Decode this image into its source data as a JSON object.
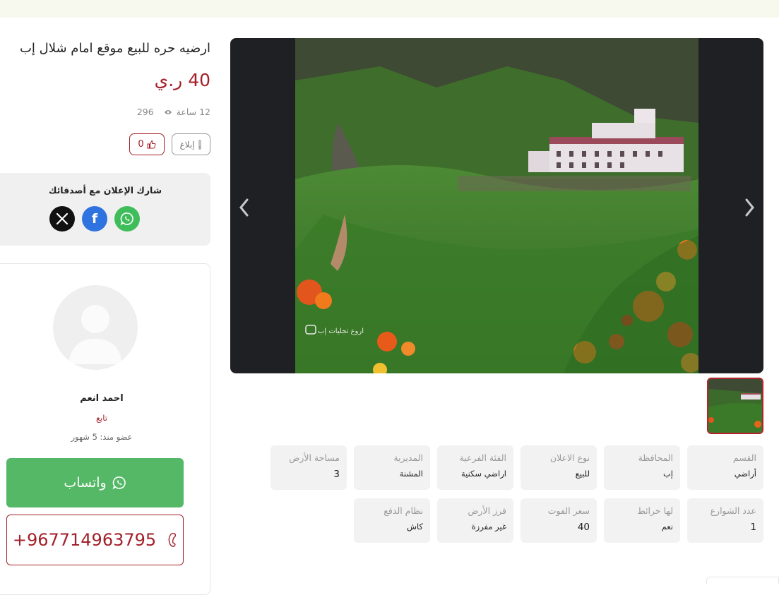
{
  "listing": {
    "title": "ارضيه حره للبيع موقع امام شلال إب",
    "price": "40 ر.ي",
    "posted": "12 ساعة",
    "views": "296",
    "report_label": "إبلاغ",
    "likes": "0"
  },
  "gallery": {
    "photo_watermark": "اروع تجليات إب"
  },
  "share": {
    "title": "شارك الإعلان مع أصدقائك",
    "buttons": [
      {
        "name": "x",
        "icon": "x-logo-icon",
        "color": "#111111"
      },
      {
        "name": "facebook",
        "icon": "facebook-icon",
        "color": "#2f73e0"
      },
      {
        "name": "whatsapp",
        "icon": "whatsapp-icon",
        "color": "#3fbd5a"
      }
    ]
  },
  "seller": {
    "name": "احمد انعم",
    "follow_label": "تابع",
    "member_since": "عضو منذ: 5 شهور",
    "whatsapp_label": "واتساب",
    "phone": "+967714963795"
  },
  "attributes": [
    {
      "label": "القسم",
      "value": "أراضي"
    },
    {
      "label": "المحافظة",
      "value": "إب"
    },
    {
      "label": "نوع الاعلان",
      "value": "للبيع"
    },
    {
      "label": "الفئة الفرعية",
      "value": "اراضي سكنية"
    },
    {
      "label": "المديرية",
      "value": "المشنة"
    },
    {
      "label": "مساحة الأرض",
      "value": "3"
    },
    {
      "label": "عدد الشوارع",
      "value": "1"
    },
    {
      "label": "لها خرائط",
      "value": "نعم"
    },
    {
      "label": "سعر الفوت",
      "value": "40"
    },
    {
      "label": "فرز الأرض",
      "value": "غير مفرزة"
    },
    {
      "label": "نظام الدفع",
      "value": "كاش"
    }
  ],
  "colors": {
    "accent": "#a3202a",
    "whatsapp_green": "#55b866",
    "gallery_bg": "#1f2024",
    "topbar": "#f7f9ef"
  }
}
